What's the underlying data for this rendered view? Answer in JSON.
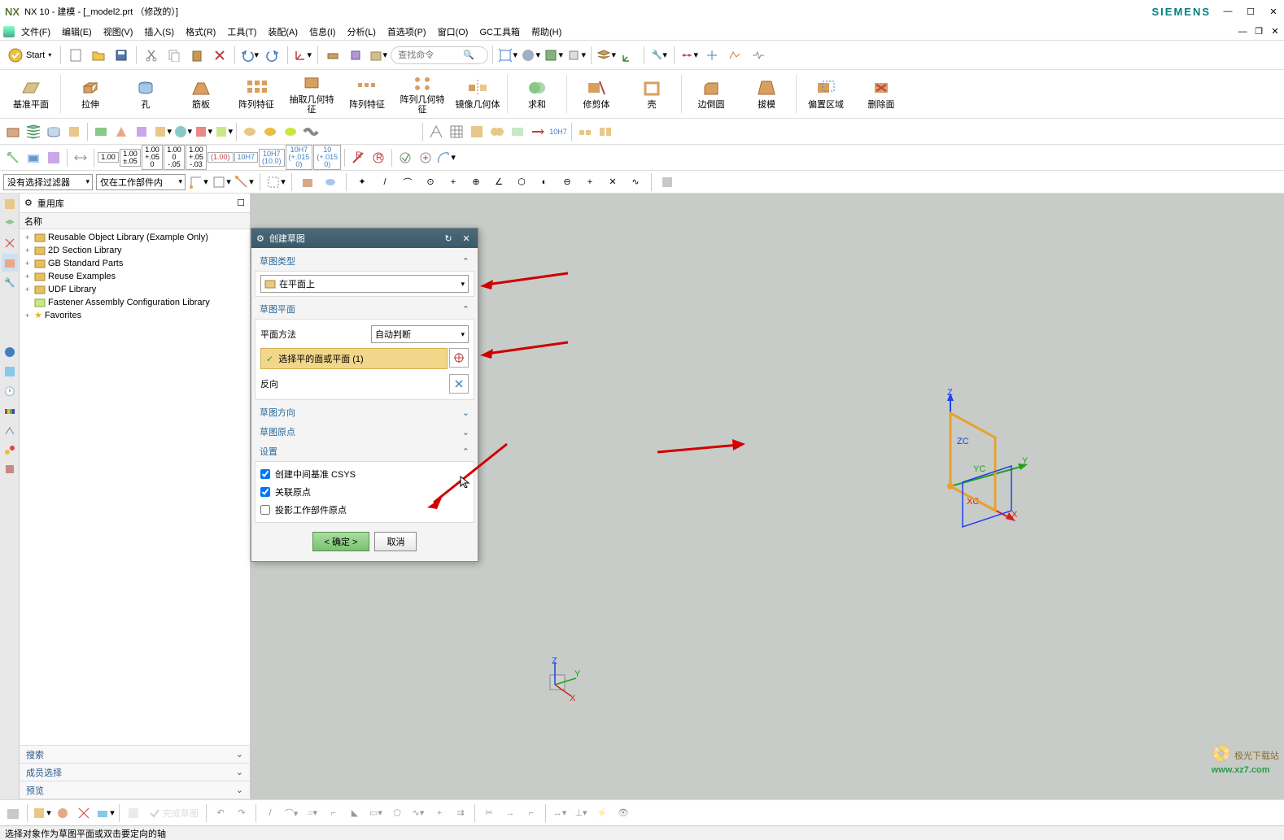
{
  "title": "NX 10 - 建模 - [_model2.prt （修改的）]",
  "brand": "SIEMENS",
  "menu": {
    "file": "文件(F)",
    "edit": "编辑(E)",
    "view": "视图(V)",
    "insert": "插入(S)",
    "format": "格式(R)",
    "tools": "工具(T)",
    "assembly": "装配(A)",
    "info": "信息(I)",
    "analysis": "分析(L)",
    "preferences": "首选项(P)",
    "window": "窗口(O)",
    "gc": "GC工具箱",
    "help": "帮助(H)"
  },
  "start": "Start",
  "search_placeholder": "查找命令",
  "ribbon": {
    "datum": "基准平面",
    "extrude": "拉伸",
    "hole": "孔",
    "rib": "筋板",
    "pattern": "阵列特征",
    "extract": "抽取几何特征",
    "pattern2": "阵列特征",
    "pattern_geo": "阵列几何特征",
    "mirror": "镜像几何体",
    "unite": "求和",
    "trim": "修剪体",
    "shell": "壳",
    "edge": "边倒圆",
    "draft": "拔模",
    "offset": "偏置区域",
    "delete": "删除面"
  },
  "filter1": "没有选择过滤器",
  "filter2": "仅在工作部件内",
  "sidebar": {
    "title": "重用库",
    "col": "名称",
    "items": [
      "Reusable Object Library (Example Only)",
      "2D Section Library",
      "GB Standard Parts",
      "Reuse Examples",
      "UDF Library",
      "Fastener Assembly Configuration Library",
      "Favorites"
    ]
  },
  "accordion": {
    "search": "搜索",
    "member": "成员选择",
    "preview": "预览"
  },
  "dialog": {
    "title": "创建草图",
    "sec_type": "草图类型",
    "type_val": "在平面上",
    "sec_plane": "草图平面",
    "plane_method": "平面方法",
    "plane_method_val": "自动判断",
    "select_face": "选择平的面或平面 (1)",
    "reverse": "反向",
    "sec_orient": "草图方向",
    "sec_origin": "草图原点",
    "sec_settings": "设置",
    "chk1": "创建中间基准 CSYS",
    "chk2": "关联原点",
    "chk3": "投影工作部件原点",
    "ok": "< 确定 >",
    "cancel": "取消"
  },
  "sketch_done": "完成草图",
  "status": "选择对象作为草图平面或双击要定向的轴",
  "watermark1": "极光下载站",
  "watermark2": "www.xz7.com",
  "tol": [
    "1.00",
    "1.00\n±.05",
    "1.00\n+.05\n0",
    "1.00\n0\n-.05",
    "1.00\n+.05\n-.03",
    "(1.00)",
    "10H7",
    "10H7\n(10.0)",
    "10H7\n(+.015\n0)",
    "10\n(+.015\n0)"
  ],
  "csys": {
    "z": "Z",
    "zc": "ZC",
    "y": "Y",
    "yc": "YC",
    "x": "X",
    "xc": "XC"
  }
}
